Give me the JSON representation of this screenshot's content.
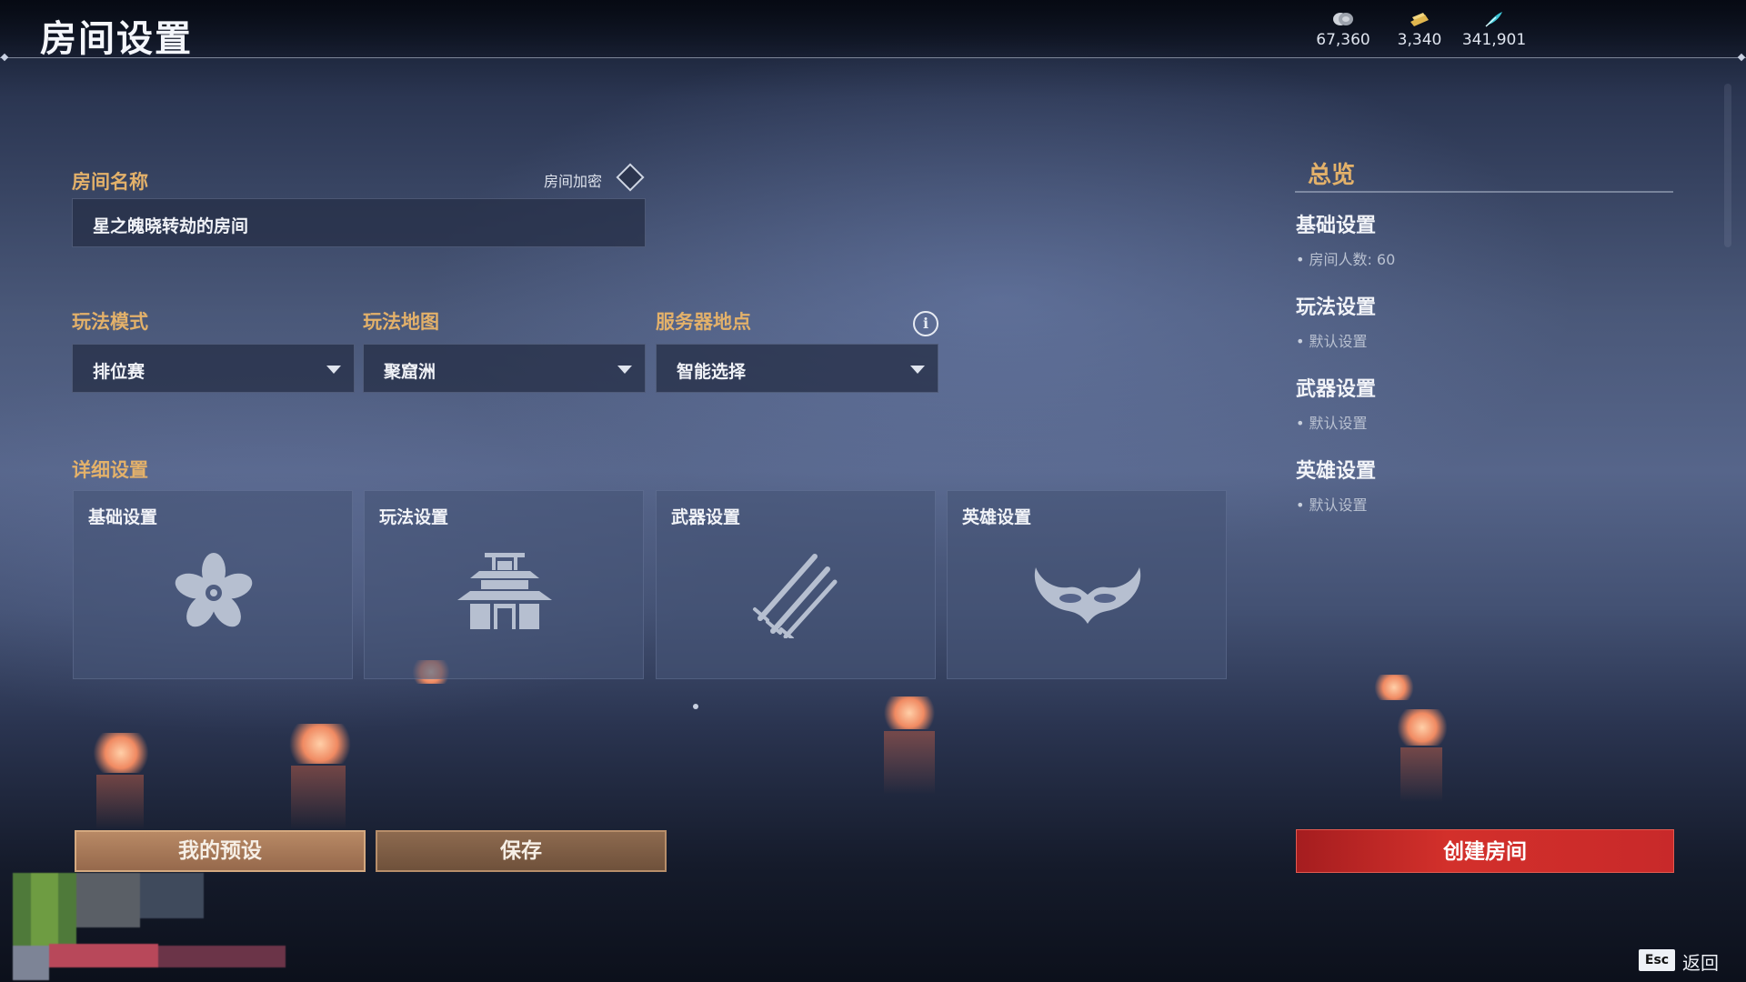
{
  "header": {
    "title": "房间设置",
    "currencies": [
      {
        "icon": "silver-coin-icon",
        "value": "67,360",
        "color": "#cfd3da"
      },
      {
        "icon": "gold-ticket-icon",
        "value": "3,340",
        "color": "#e0b64e"
      },
      {
        "icon": "cyan-feather-icon",
        "value": "341,901",
        "color": "#3ec7d8"
      }
    ]
  },
  "room": {
    "name_label": "房间名称",
    "name_value": "星之魄晓转劫的房间",
    "encrypt_label": "房间加密"
  },
  "selectors": {
    "mode": {
      "label": "玩法模式",
      "value": "排位赛"
    },
    "map": {
      "label": "玩法地图",
      "value": "聚窟洲"
    },
    "server": {
      "label": "服务器地点",
      "value": "智能选择"
    },
    "info_icon": "info-icon"
  },
  "details": {
    "label": "详细设置",
    "cards": [
      {
        "title": "基础设置",
        "icon": "flower-icon"
      },
      {
        "title": "玩法设置",
        "icon": "temple-icon"
      },
      {
        "title": "武器设置",
        "icon": "swords-icon"
      },
      {
        "title": "英雄设置",
        "icon": "mask-icon"
      }
    ]
  },
  "overview": {
    "title": "总览",
    "sections": [
      {
        "heading": "基础设置",
        "item": "房间人数: 60"
      },
      {
        "heading": "玩法设置",
        "item": "默认设置"
      },
      {
        "heading": "武器设置",
        "item": "默认设置"
      },
      {
        "heading": "英雄设置",
        "item": "默认设置"
      }
    ]
  },
  "buttons": {
    "preset": "我的预设",
    "save": "保存",
    "create": "创建房间"
  },
  "footer": {
    "esc_key": "Esc",
    "back": "返回"
  },
  "colors": {
    "accent_label": "#e3b16a",
    "create_button": "#c8292a",
    "brown_button": "#a87a5a"
  }
}
